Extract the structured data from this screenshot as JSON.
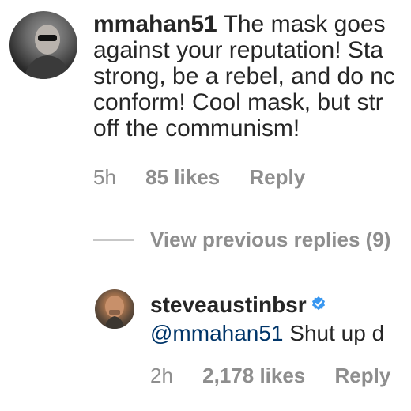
{
  "comment": {
    "username": "mmahan51",
    "lines": [
      "The mask goes",
      "against your reputation!  Sta",
      "strong, be a rebel, and do nc",
      "conform!  Cool mask, but str",
      "off the communism!"
    ],
    "time": "5h",
    "likes": "85 likes",
    "reply_label": "Reply"
  },
  "view_previous": "View previous replies (9)",
  "reply": {
    "username": "steveaustinbsr",
    "verified_icon": "verified-badge-icon",
    "mention": "@mmahan51",
    "text": "Shut up d",
    "time": "2h",
    "likes": "2,178 likes",
    "reply_label": "Reply"
  },
  "colors": {
    "text": "#262626",
    "muted": "#8e8e8e",
    "mention": "#003569",
    "verified": "#3897f0"
  }
}
